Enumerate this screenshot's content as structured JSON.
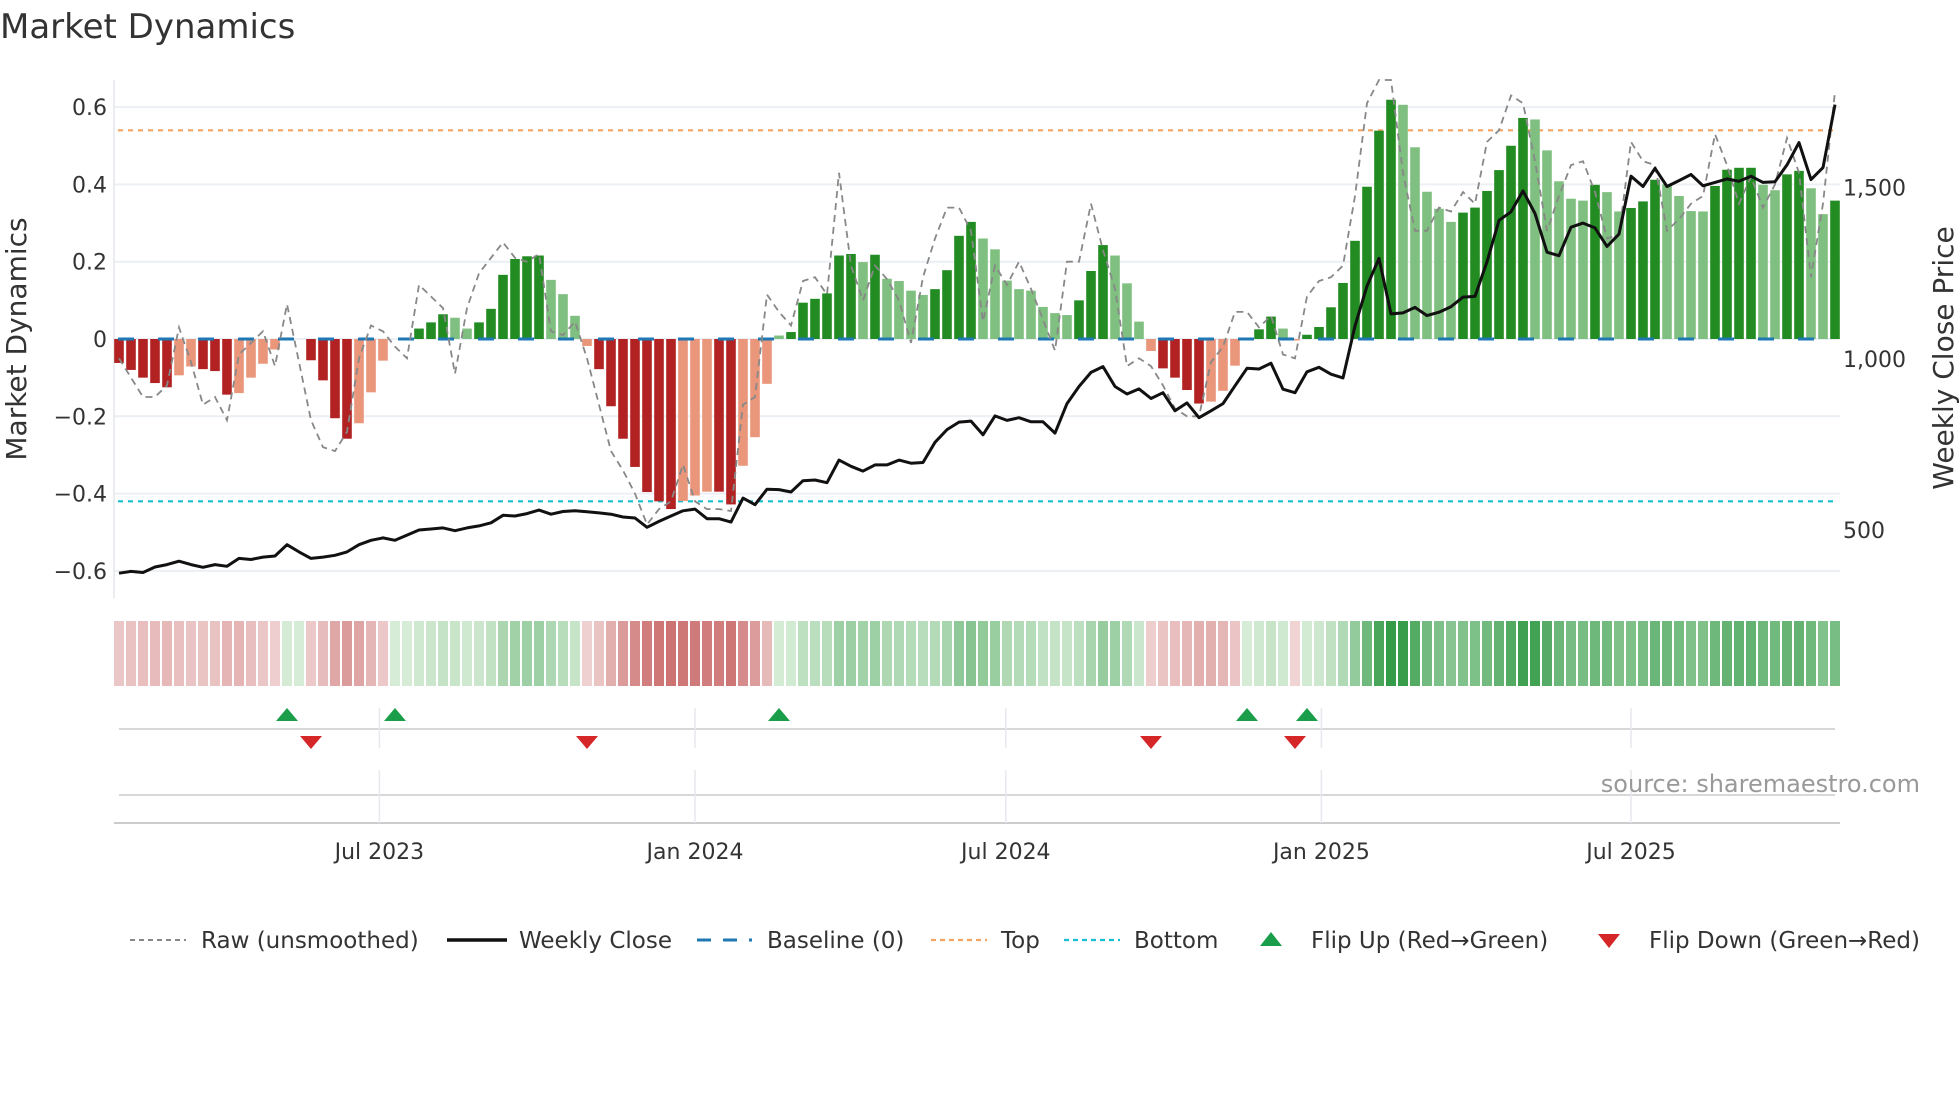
{
  "chart_data": {
    "type": "bar",
    "title": "Market Dynamics",
    "ylabel": "Market Dynamics",
    "y2label": "Weekly Close Price",
    "ylim": [
      -0.67,
      0.67
    ],
    "y2lim": [
      380,
      1860
    ],
    "yticks": [
      {
        "v": 0.6,
        "label": "0.6"
      },
      {
        "v": 0.4,
        "label": "0.4"
      },
      {
        "v": 0.2,
        "label": "0.2"
      },
      {
        "v": 0,
        "label": "0"
      },
      {
        "v": -0.2,
        "label": "−0.2"
      },
      {
        "v": -0.4,
        "label": "−0.4"
      },
      {
        "v": -0.6,
        "label": "−0.6"
      }
    ],
    "y2ticks": [
      {
        "v": 1500,
        "label": "1,500"
      },
      {
        "v": 1000,
        "label": "1,000"
      },
      {
        "v": 500,
        "label": "500"
      }
    ],
    "xticks": [
      {
        "week": 21.7,
        "label": "Jul 2023"
      },
      {
        "week": 48,
        "label": "Jan 2024"
      },
      {
        "week": 73.9,
        "label": "Jul 2024"
      },
      {
        "week": 100.2,
        "label": "Jan 2025"
      },
      {
        "week": 126,
        "label": "Jul 2025"
      }
    ],
    "top_level": 0.54,
    "bottom_level": -0.42,
    "baseline": 0,
    "momentum": [
      -0.062,
      -0.08,
      -0.1,
      -0.114,
      -0.125,
      -0.094,
      -0.071,
      -0.078,
      -0.083,
      -0.144,
      -0.14,
      -0.1,
      -0.064,
      -0.027,
      0.004,
      0,
      -0.055,
      -0.107,
      -0.205,
      -0.258,
      -0.218,
      -0.138,
      -0.056,
      0,
      0,
      0.027,
      0.043,
      0.064,
      0.055,
      0.027,
      0.043,
      0.078,
      0.166,
      0.207,
      0.214,
      0.216,
      0.153,
      0.116,
      0.06,
      -0.018,
      -0.078,
      -0.174,
      -0.258,
      -0.331,
      -0.396,
      -0.42,
      -0.44,
      -0.419,
      -0.405,
      -0.395,
      -0.395,
      -0.428,
      -0.328,
      -0.254,
      -0.116,
      0.009,
      0.018,
      0.094,
      0.104,
      0.118,
      0.216,
      0.22,
      0.199,
      0.218,
      0.156,
      0.15,
      0.125,
      0.114,
      0.129,
      0.178,
      0.267,
      0.303,
      0.26,
      0.232,
      0.151,
      0.129,
      0.125,
      0.083,
      0.067,
      0.062,
      0.1,
      0.176,
      0.243,
      0.216,
      0.144,
      0.045,
      -0.031,
      -0.076,
      -0.1,
      -0.132,
      -0.167,
      -0.162,
      -0.134,
      -0.069,
      0,
      0.025,
      0.058,
      0.027,
      -0.002,
      0.011,
      0.031,
      0.082,
      0.145,
      0.254,
      0.394,
      0.539,
      0.619,
      0.606,
      0.496,
      0.381,
      0.337,
      0.303,
      0.327,
      0.34,
      0.383,
      0.437,
      0.5,
      0.572,
      0.568,
      0.488,
      0.408,
      0.363,
      0.358,
      0.399,
      0.38,
      0.33,
      0.339,
      0.356,
      0.412,
      0.4,
      0.37,
      0.331,
      0.33,
      0.396,
      0.438,
      0.443,
      0.443,
      0.399,
      0.385,
      0.426,
      0.435,
      0.39,
      0.323,
      0.358
    ],
    "raw": [
      -0.05,
      -0.1,
      -0.15,
      -0.15,
      -0.12,
      0.03,
      -0.06,
      -0.17,
      -0.15,
      -0.21,
      -0.04,
      -0.01,
      0.02,
      -0.07,
      0.09,
      -0.06,
      -0.21,
      -0.28,
      -0.29,
      -0.24,
      -0.05,
      0.035,
      0.02,
      -0.02,
      -0.05,
      0.14,
      0.11,
      0.08,
      -0.09,
      0.08,
      0.17,
      0.21,
      0.25,
      0.21,
      0.2,
      0.22,
      0.02,
      0.01,
      0.045,
      -0.05,
      -0.17,
      -0.29,
      -0.34,
      -0.4,
      -0.48,
      -0.44,
      -0.42,
      -0.325,
      -0.42,
      -0.44,
      -0.44,
      -0.445,
      -0.17,
      -0.15,
      0.115,
      0.07,
      0.035,
      0.15,
      0.16,
      0.115,
      0.43,
      0.19,
      0.1,
      0.19,
      0.155,
      0.1,
      -0.01,
      0.16,
      0.26,
      0.34,
      0.34,
      0.28,
      0.045,
      0.19,
      0.14,
      0.2,
      0.13,
      0.05,
      -0.03,
      0.2,
      0.2,
      0.35,
      0.23,
      0.13,
      -0.07,
      -0.05,
      -0.07,
      -0.12,
      -0.18,
      -0.2,
      -0.2,
      -0.06,
      -0.02,
      0.07,
      0.07,
      0.03,
      0.06,
      -0.04,
      -0.05,
      0.11,
      0.15,
      0.16,
      0.19,
      0.37,
      0.61,
      0.67,
      0.67,
      0.43,
      0.28,
      0.28,
      0.34,
      0.33,
      0.38,
      0.35,
      0.51,
      0.54,
      0.63,
      0.61,
      0.46,
      0.28,
      0.37,
      0.45,
      0.46,
      0.38,
      0.26,
      0.27,
      0.51,
      0.46,
      0.45,
      0.28,
      0.31,
      0.35,
      0.37,
      0.53,
      0.45,
      0.35,
      0.42,
      0.34,
      0.4,
      0.52,
      0.43,
      0.16,
      0.35,
      0.64
    ],
    "weekly_close": [
      374,
      379,
      376,
      392,
      399,
      409,
      399,
      391,
      399,
      394,
      417,
      414,
      421,
      424,
      457,
      436,
      417,
      421,
      426,
      436,
      457,
      470,
      477,
      470,
      485,
      500,
      503,
      506,
      498,
      506,
      512,
      521,
      543,
      541,
      548,
      558,
      546,
      554,
      556,
      553,
      550,
      546,
      538,
      535,
      508,
      525,
      541,
      556,
      561,
      533,
      533,
      523,
      593,
      574,
      619,
      618,
      611,
      644,
      646,
      638,
      704,
      686,
      672,
      690,
      690,
      704,
      695,
      697,
      756,
      793,
      815,
      818,
      778,
      833,
      820,
      828,
      816,
      816,
      783,
      869,
      919,
      960,
      977,
      919,
      897,
      912,
      884,
      901,
      848,
      871,
      828,
      848,
      869,
      921,
      972,
      970,
      987,
      911,
      901,
      962,
      975,
      955,
      944,
      1096,
      1212,
      1293,
      1131,
      1134,
      1150,
      1126,
      1136,
      1152,
      1180,
      1182,
      1283,
      1404,
      1429,
      1490,
      1424,
      1311,
      1301,
      1384,
      1396,
      1382,
      1328,
      1364,
      1533,
      1503,
      1556,
      1503,
      1520,
      1538,
      1505,
      1515,
      1525,
      1518,
      1533,
      1515,
      1517,
      1566,
      1631,
      1523,
      1558,
      1742
    ],
    "flip_up_weeks": [
      14,
      23,
      55,
      94,
      99
    ],
    "flip_down_weeks": [
      16,
      39,
      86,
      98
    ],
    "legend": {
      "raw": "Raw (unsmoothed)",
      "close": "Weekly Close",
      "baseline": "Baseline (0)",
      "top": "Top",
      "bottom": "Bottom",
      "flip_up": "Flip Up (Red→Green)",
      "flip_down": "Flip Down (Green→Red)"
    },
    "legend_placement": "bottom",
    "source": "source: sharemaestro.com",
    "colors": {
      "pos_strong": "#228b22",
      "pos_weak": "#7fbf7f",
      "neg_strong": "#b22222",
      "neg_weak": "#e9967a",
      "baseline": "#1f77b4",
      "top": "#f4a460",
      "bottom": "#17becf",
      "raw": "#888888",
      "close": "#111111",
      "flip_up": "#1a9e4a",
      "flip_down": "#d62728"
    }
  }
}
